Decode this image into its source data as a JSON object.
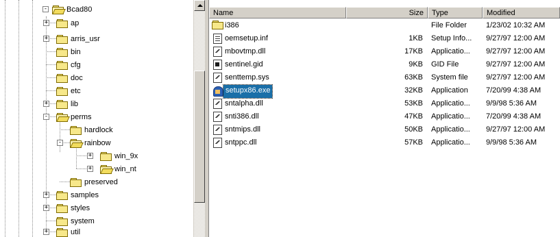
{
  "tree": {
    "items": [
      {
        "label": "Bcad80",
        "expander": "-",
        "open": true
      },
      {
        "label": "ap",
        "expander": "+",
        "open": false
      },
      {
        "label": "arris_usr",
        "expander": "+",
        "open": false
      },
      {
        "label": "bin",
        "expander": "",
        "open": false
      },
      {
        "label": "cfg",
        "expander": "",
        "open": false
      },
      {
        "label": "doc",
        "expander": "",
        "open": false
      },
      {
        "label": "etc",
        "expander": "",
        "open": false
      },
      {
        "label": "lib",
        "expander": "+",
        "open": false
      },
      {
        "label": "perms",
        "expander": "-",
        "open": true
      },
      {
        "label": "hardlock",
        "expander": "",
        "open": false
      },
      {
        "label": "rainbow",
        "expander": "-",
        "open": true
      },
      {
        "label": "win_9x",
        "expander": "+",
        "open": false
      },
      {
        "label": "win_nt",
        "expander": "+",
        "open": true
      },
      {
        "label": "preserved",
        "expander": "",
        "open": false
      },
      {
        "label": "samples",
        "expander": "+",
        "open": false
      },
      {
        "label": "styles",
        "expander": "+",
        "open": false
      },
      {
        "label": "system",
        "expander": "",
        "open": false
      },
      {
        "label": "util",
        "expander": "+",
        "open": false
      }
    ]
  },
  "list": {
    "columns": {
      "name": "Name",
      "size": "Size",
      "type": "Type",
      "modified": "Modified"
    },
    "rows": [
      {
        "name": "i386",
        "size": "",
        "type": "File Folder",
        "modified": "1/23/02 10:32 AM",
        "icon": "folder-icon",
        "selected": false
      },
      {
        "name": "oemsetup.inf",
        "size": "1KB",
        "type": "Setup Info...",
        "modified": "9/27/97 12:00 AM",
        "icon": "setup-info-icon",
        "selected": false
      },
      {
        "name": "mbovtmp.dll",
        "size": "17KB",
        "type": "Applicatio...",
        "modified": "9/27/97 12:00 AM",
        "icon": "dll-icon",
        "selected": false
      },
      {
        "name": "sentinel.gid",
        "size": "9KB",
        "type": "GID File",
        "modified": "9/27/97 12:00 AM",
        "icon": "gid-icon",
        "selected": false
      },
      {
        "name": "senttemp.sys",
        "size": "63KB",
        "type": "System file",
        "modified": "9/27/97 12:00 AM",
        "icon": "sys-icon",
        "selected": false
      },
      {
        "name": "setupx86.exe",
        "size": "32KB",
        "type": "Application",
        "modified": "7/20/99 4:38 AM",
        "icon": "exe-icon",
        "selected": true
      },
      {
        "name": "sntalpha.dll",
        "size": "53KB",
        "type": "Applicatio...",
        "modified": "9/9/98 5:36 AM",
        "icon": "dll-icon",
        "selected": false
      },
      {
        "name": "snti386.dll",
        "size": "47KB",
        "type": "Applicatio...",
        "modified": "7/20/99 4:38 AM",
        "icon": "dll-icon",
        "selected": false
      },
      {
        "name": "sntmips.dll",
        "size": "50KB",
        "type": "Applicatio...",
        "modified": "9/27/97 12:00 AM",
        "icon": "dll-icon",
        "selected": false
      },
      {
        "name": "sntppc.dll",
        "size": "57KB",
        "type": "Applicatio...",
        "modified": "9/9/98 5:36 AM",
        "icon": "dll-icon",
        "selected": false
      }
    ]
  },
  "colors": {
    "selection": "#1a6fa8",
    "folder": "#f7e88a",
    "chrome": "#d4d0c8"
  }
}
